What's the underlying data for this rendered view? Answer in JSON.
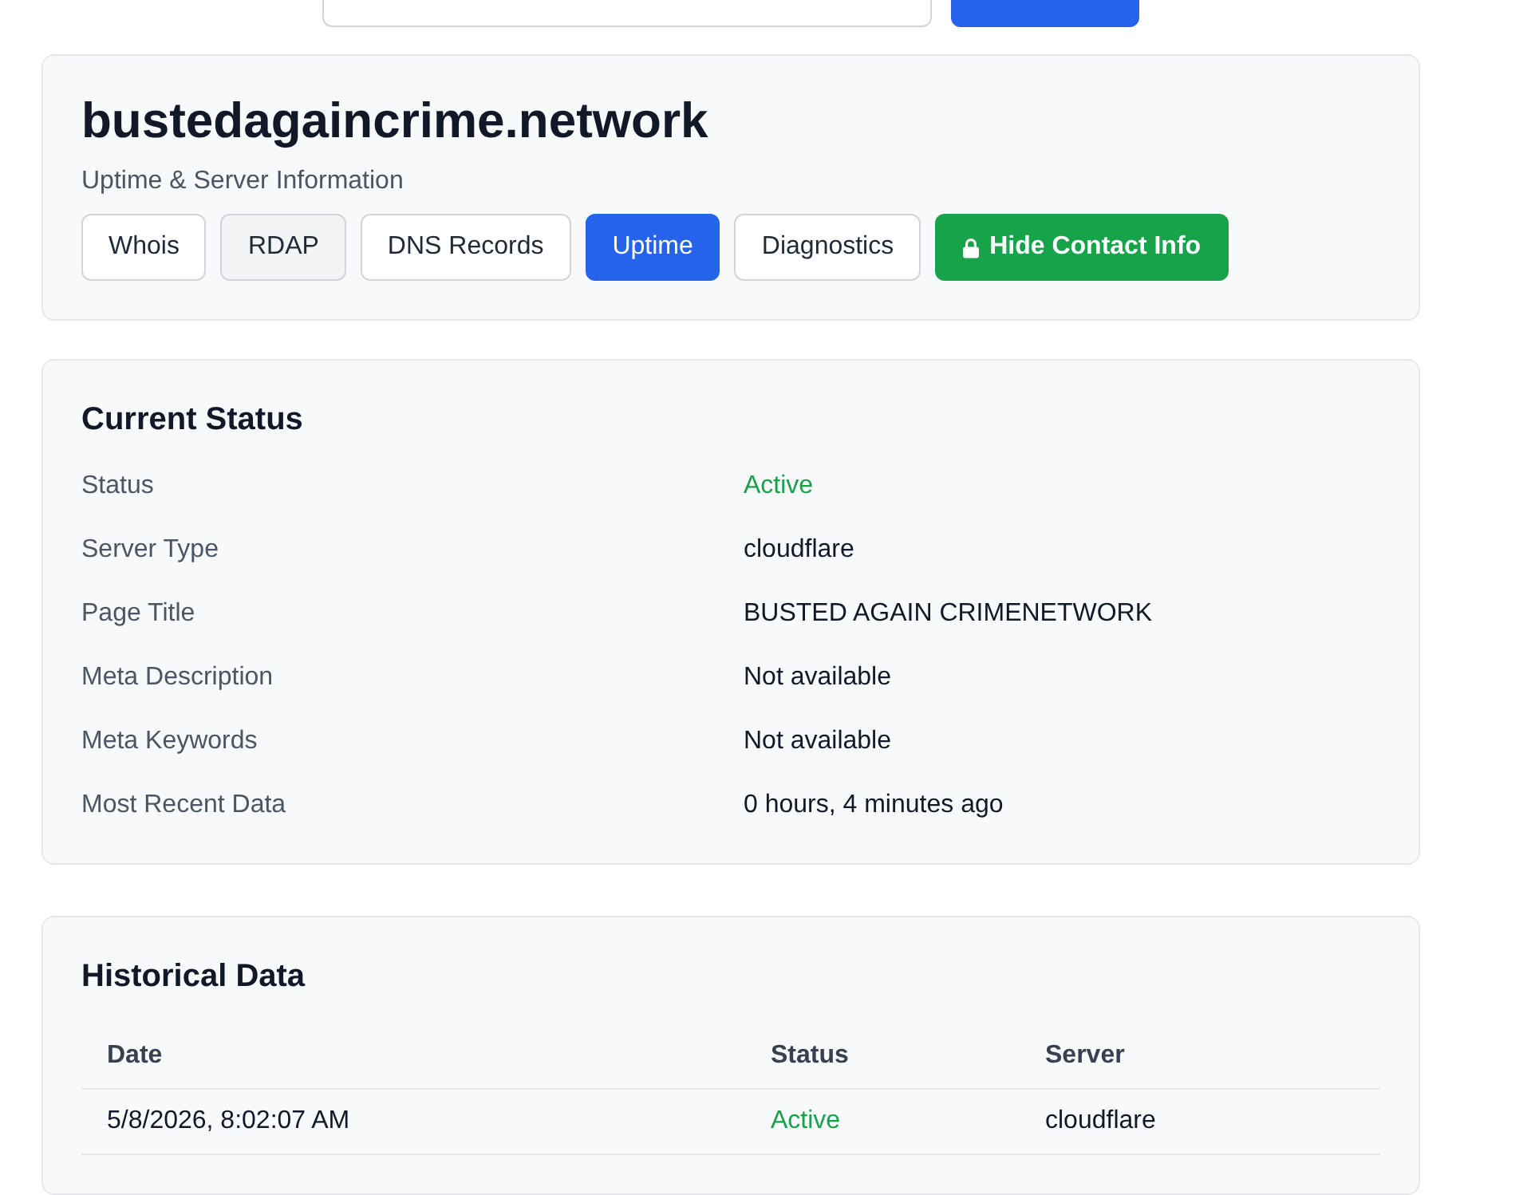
{
  "search": {
    "field": true,
    "button": true
  },
  "header": {
    "title": "bustedagaincrime.network",
    "subtitle": "Uptime & Server Information"
  },
  "tabs": [
    {
      "label": "Whois",
      "selected": false,
      "hovered": false
    },
    {
      "label": "RDAP",
      "selected": false,
      "hovered": true
    },
    {
      "label": "DNS Records",
      "selected": false,
      "hovered": false
    },
    {
      "label": "Uptime",
      "selected": true,
      "hovered": false
    },
    {
      "label": "Diagnostics",
      "selected": false,
      "hovered": false
    }
  ],
  "contact_button": {
    "label": "Hide Contact Info"
  },
  "current_status": {
    "title": "Current Status",
    "rows": [
      {
        "label": "Status",
        "value": "Active",
        "kind": "status"
      },
      {
        "label": "Server Type",
        "value": "cloudflare",
        "kind": "text"
      },
      {
        "label": "Page Title",
        "value": "BUSTED AGAIN CRIMENETWORK",
        "kind": "text"
      },
      {
        "label": "Meta Description",
        "value": "Not available",
        "kind": "text"
      },
      {
        "label": "Meta Keywords",
        "value": "Not available",
        "kind": "text"
      },
      {
        "label": "Most Recent Data",
        "value": "0 hours, 4 minutes ago",
        "kind": "text"
      }
    ]
  },
  "historical_data": {
    "title": "Historical Data",
    "columns": [
      "Date",
      "Status",
      "Server"
    ],
    "rows": [
      {
        "date": "5/8/2026, 8:02:07 AM",
        "status": "Active",
        "server": "cloudflare"
      }
    ]
  }
}
